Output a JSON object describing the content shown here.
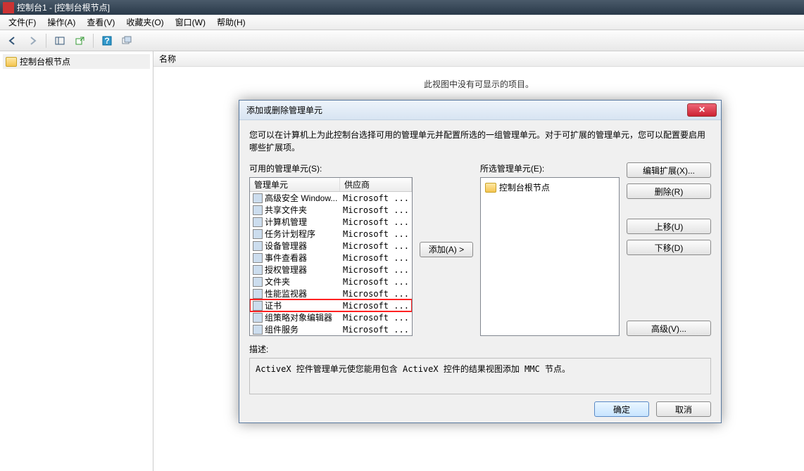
{
  "window": {
    "title": "控制台1 - [控制台根节点]"
  },
  "menu": {
    "file": "文件(F)",
    "action": "操作(A)",
    "view": "查看(V)",
    "favorites": "收藏夹(O)",
    "window": "窗口(W)",
    "help": "帮助(H)"
  },
  "tree": {
    "root": "控制台根节点"
  },
  "content": {
    "header": "名称",
    "empty": "此视图中没有可显示的项目。"
  },
  "dialog": {
    "title": "添加或删除管理单元",
    "instruction": "您可以在计算机上为此控制台选择可用的管理单元并配置所选的一组管理单元。对于可扩展的管理单元，您可以配置要启用哪些扩展项。",
    "available_label": "可用的管理单元(S):",
    "selected_label": "所选管理单元(E):",
    "col_snapin": "管理单元",
    "col_vendor": "供应商",
    "add_btn": "添加(A) >",
    "edit_ext_btn": "编辑扩展(X)...",
    "remove_btn": "删除(R)",
    "moveup_btn": "上移(U)",
    "movedown_btn": "下移(D)",
    "advanced_btn": "高级(V)...",
    "desc_label": "描述:",
    "desc_text": "ActiveX 控件管理单元使您能用包含 ActiveX 控件的结果视图添加 MMC 节点。",
    "ok": "确定",
    "cancel": "取消",
    "selected_root": "控制台根节点",
    "snapins": [
      {
        "name": "高级安全 Window...",
        "vendor": "Microsoft ...",
        "highlight": false
      },
      {
        "name": "共享文件夹",
        "vendor": "Microsoft ...",
        "highlight": false
      },
      {
        "name": "计算机管理",
        "vendor": "Microsoft ...",
        "highlight": false
      },
      {
        "name": "任务计划程序",
        "vendor": "Microsoft ...",
        "highlight": false
      },
      {
        "name": "设备管理器",
        "vendor": "Microsoft ...",
        "highlight": false
      },
      {
        "name": "事件查看器",
        "vendor": "Microsoft ...",
        "highlight": false
      },
      {
        "name": "授权管理器",
        "vendor": "Microsoft ...",
        "highlight": false
      },
      {
        "name": "文件夹",
        "vendor": "Microsoft ...",
        "highlight": false
      },
      {
        "name": "性能监视器",
        "vendor": "Microsoft ...",
        "highlight": false
      },
      {
        "name": "证书",
        "vendor": "Microsoft ...",
        "highlight": true
      },
      {
        "name": "组策略对象编辑器",
        "vendor": "Microsoft ...",
        "highlight": false
      },
      {
        "name": "组件服务",
        "vendor": "Microsoft ...",
        "highlight": false
      }
    ]
  }
}
